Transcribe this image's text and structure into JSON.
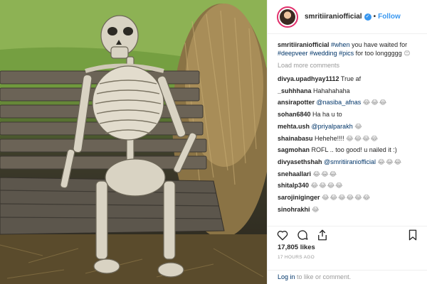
{
  "post": {
    "username": "smritiiraniofficial",
    "verified_mark": "✓",
    "separator": "•",
    "follow_label": "Follow",
    "caption": {
      "text_pre": "you have waited for",
      "tag_when": "#when",
      "tag_deepveer": "#deepveer",
      "tag_wedding": "#wedding",
      "tag_pics": "#pics",
      "text_post": "for too longgggg",
      "emoji": "😊"
    },
    "load_more": "Load more comments",
    "comments": [
      {
        "user": "divya.upadhyay1112",
        "text": "True af",
        "emoji": ""
      },
      {
        "user": "_suhhhana",
        "text": "Hahahahaha",
        "emoji": ""
      },
      {
        "user": "ansirapotter",
        "mention": "@nasiba_afnas",
        "text": "",
        "emoji": "😂😂😂"
      },
      {
        "user": "sohan6840",
        "text": "Ha ha u to",
        "emoji": ""
      },
      {
        "user": "mehta.ush",
        "mention": "@priyalparakh",
        "text": "",
        "emoji": "😂"
      },
      {
        "user": "shainabasu",
        "text": "Hehehe!!!!",
        "emoji": "😂😂😂😂"
      },
      {
        "user": "sagmohan",
        "text": "ROFL .. too good! u nailed it :)",
        "emoji": ""
      },
      {
        "user": "divyasethshah",
        "mention": "@smritiiraniofficial",
        "text": "",
        "emoji": "😂😂😂"
      },
      {
        "user": "snehaallari",
        "text": "",
        "emoji": "😂😂😂"
      },
      {
        "user": "shitalp340",
        "text": "",
        "emoji": "😂😂😂😂"
      },
      {
        "user": "sarojiniginger",
        "text": "",
        "emoji": "😂😂😂😂😂😂"
      },
      {
        "user": "sinohrakhi",
        "text": "",
        "emoji": "😂"
      }
    ],
    "likes": "17,805 likes",
    "time_ago": "17 HOURS AGO",
    "footer": {
      "login_link": "Log in",
      "rest": "to like or comment."
    },
    "icons": {
      "like": "heart-icon",
      "comment": "comment-icon",
      "share": "share-icon",
      "save": "bookmark-icon"
    },
    "colors": {
      "accent": "#3897f0",
      "link": "#003569",
      "muted": "#999999"
    }
  }
}
